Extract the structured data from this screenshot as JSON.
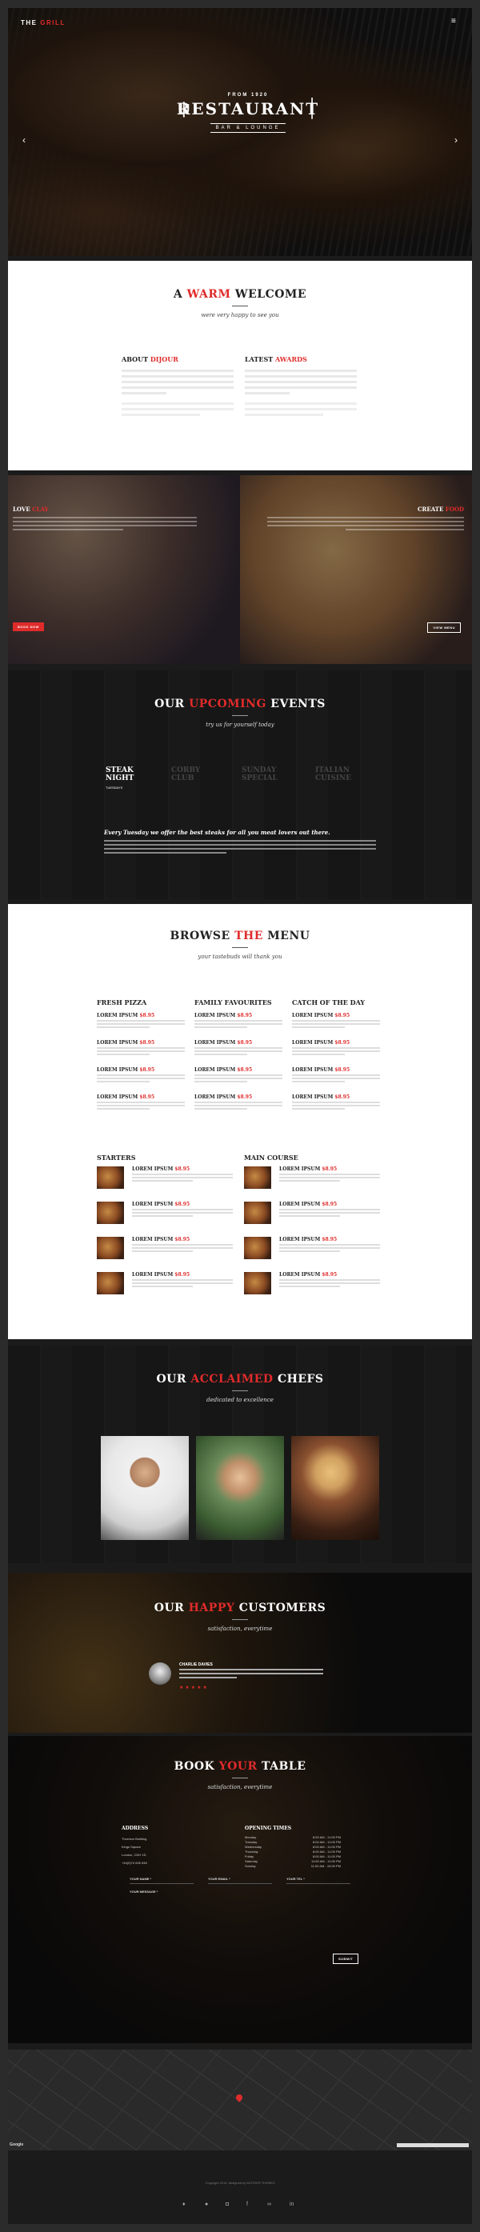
{
  "header": {
    "logo_prefix": "THE ",
    "logo_accent": "GRILL",
    "menu_icon": "hamburger-menu-icon"
  },
  "hero": {
    "from": "FROM 1920",
    "name": "RESTAURANT",
    "sub": "BAR & LOUNGE",
    "prev": "‹",
    "next": "›"
  },
  "welcome": {
    "title_a": "A ",
    "title_r": "WARM",
    "title_b": " WELCOME",
    "tagline": "were very happy to see you",
    "about_a": "ABOUT ",
    "about_r": "DIJOUR",
    "awards_a": "LATEST ",
    "awards_r": "AWARDS"
  },
  "features": {
    "love_a": "LOVE ",
    "love_r": "CLAY",
    "book_btn": "BOOK NOW",
    "create_a": "CREATE ",
    "create_r": "FOOD",
    "view_btn": "VIEW MENU"
  },
  "events": {
    "title_a": "OUR ",
    "title_r": "UPCOMING",
    "title_b": " EVENTS",
    "tagline": "try us for yourself today",
    "tabs": [
      {
        "l1": "STEAK",
        "l2": "NIGHT",
        "day": "TUESDAYS"
      },
      {
        "l1": "CORBY",
        "l2": "CLUB",
        "day": ""
      },
      {
        "l1": "SUNDAY",
        "l2": "SPECIAL",
        "day": ""
      },
      {
        "l1": "ITALIAN",
        "l2": "CUISINE",
        "day": ""
      }
    ],
    "headline": "Every Tuesday we offer the best steaks for all you meat lovers out there."
  },
  "menu": {
    "title_a": "BROWSE ",
    "title_r": "THE",
    "title_b": " MENU",
    "tagline": "your tastebuds will thank you",
    "columns": [
      {
        "heading": "FRESH PIZZA",
        "items": [
          {
            "name": "LOREM IPSUM",
            "price": "$8.95"
          },
          {
            "name": "LOREM IPSUM",
            "price": "$8.95"
          },
          {
            "name": "LOREM IPSUM",
            "price": "$8.95"
          },
          {
            "name": "LOREM IPSUM",
            "price": "$8.95"
          }
        ]
      },
      {
        "heading": "FAMILY FAVOURITES",
        "items": [
          {
            "name": "LOREM IPSUM",
            "price": "$8.95"
          },
          {
            "name": "LOREM IPSUM",
            "price": "$8.95"
          },
          {
            "name": "LOREM IPSUM",
            "price": "$8.95"
          },
          {
            "name": "LOREM IPSUM",
            "price": "$8.95"
          }
        ]
      },
      {
        "heading": "CATCH OF THE DAY",
        "items": [
          {
            "name": "LOREM IPSUM",
            "price": "$8.95"
          },
          {
            "name": "LOREM IPSUM",
            "price": "$8.95"
          },
          {
            "name": "LOREM IPSUM",
            "price": "$8.95"
          },
          {
            "name": "LOREM IPSUM",
            "price": "$8.95"
          }
        ]
      }
    ],
    "starters": {
      "heading": "STARTERS",
      "items": [
        {
          "name": "LOREM IPSUM",
          "price": "$8.95"
        },
        {
          "name": "LOREM IPSUM",
          "price": "$8.95"
        },
        {
          "name": "LOREM IPSUM",
          "price": "$8.95"
        },
        {
          "name": "LOREM IPSUM",
          "price": "$8.95"
        }
      ]
    },
    "main": {
      "heading": "MAIN COURSE",
      "items": [
        {
          "name": "LOREM IPSUM",
          "price": "$8.95"
        },
        {
          "name": "LOREM IPSUM",
          "price": "$8.95"
        },
        {
          "name": "LOREM IPSUM",
          "price": "$8.95"
        },
        {
          "name": "LOREM IPSUM",
          "price": "$8.95"
        }
      ]
    }
  },
  "chefs": {
    "title_a": "OUR ",
    "title_r": "ACCLAIMED",
    "title_b": " CHEFS",
    "tagline": "dedicated to excellence"
  },
  "customers": {
    "title_a": "OUR ",
    "title_r": "HAPPY",
    "title_b": " CUSTOMERS",
    "tagline": "satisfaction, everytime",
    "name": "CHARLIE DAVIES"
  },
  "booking": {
    "title_a": "BOOK ",
    "title_r": "YOUR",
    "title_b": " TABLE",
    "tagline": "satisfaction, everytime",
    "address_h": "ADDRESS",
    "address": [
      "Thornton Building",
      "Kings Square",
      "London, CDH 1D",
      "+44(0)74 626 548"
    ],
    "hours_h": "OPENING TIMES",
    "hours": [
      {
        "day": "Monday",
        "time": "8:00 AM - 11:00 PM"
      },
      {
        "day": "Tuesday",
        "time": "8:00 AM - 11:00 PM"
      },
      {
        "day": "Wednesday",
        "time": "8:00 AM - 11:00 PM"
      },
      {
        "day": "Thursday",
        "time": "8:00 AM - 11:00 PM"
      },
      {
        "day": "Friday",
        "time": "8:00 AM - 11:00 PM"
      },
      {
        "day": "Saturday",
        "time": "11:00 AM - 11:00 PM"
      },
      {
        "day": "Sunday",
        "time": "11:00 AM - 10:00 PM"
      }
    ],
    "f_name": "YOUR NAME *",
    "f_email": "YOUR EMAIL *",
    "f_tel": "YOUR TEL *",
    "f_message": "YOUR MESSAGE *",
    "submit": "SUBMIT"
  },
  "footer": {
    "copyright": "Copyright 2016, designed by MOTHER THEMES",
    "map_brand": "Google"
  }
}
